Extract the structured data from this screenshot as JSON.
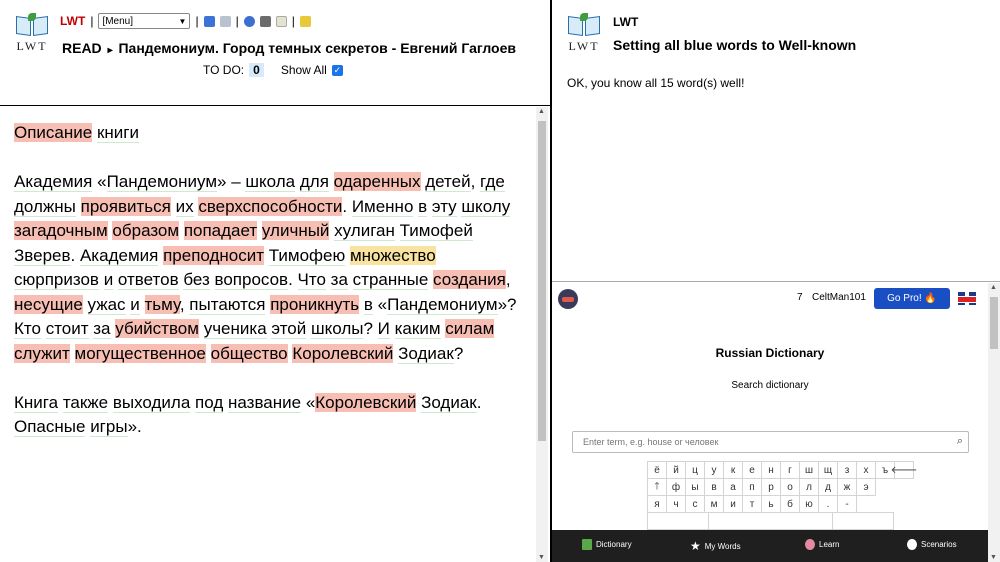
{
  "left": {
    "logo_text": "LWT",
    "toolbar": {
      "lwt": "LWT",
      "sep": "|",
      "menu_value": "[Menu]"
    },
    "title": {
      "mode": "READ",
      "arrow": "▸",
      "text": "Пандемониум. Город темных секретов - Евгений Гаглоев"
    },
    "todo": {
      "label": "TO DO:",
      "count": "0",
      "show_all": "Show All"
    }
  },
  "text": {
    "paragraphs": [
      [
        {
          "t": "Описание",
          "s": "u"
        },
        {
          "t": " "
        },
        {
          "t": "книги",
          "s": "k"
        }
      ],
      [
        {
          "t": "Академия",
          "s": "k"
        },
        {
          "t": " «"
        },
        {
          "t": "Пандемониум",
          "s": "k"
        },
        {
          "t": "» – "
        },
        {
          "t": "школа",
          "s": "k"
        },
        {
          "t": " "
        },
        {
          "t": "для",
          "s": "k"
        },
        {
          "t": " "
        },
        {
          "t": "одаренных",
          "s": "u"
        },
        {
          "t": " "
        },
        {
          "t": "детей",
          "s": "k"
        },
        {
          "t": ", "
        },
        {
          "t": "где",
          "s": "k"
        },
        {
          "t": " "
        },
        {
          "t": "должны",
          "s": "k"
        },
        {
          "t": " "
        },
        {
          "t": "проявиться",
          "s": "u"
        },
        {
          "t": " "
        },
        {
          "t": "их",
          "s": "k"
        },
        {
          "t": " "
        },
        {
          "t": "сверхспособности",
          "s": "u"
        },
        {
          "t": ". "
        },
        {
          "t": "Именно",
          "s": "k"
        },
        {
          "t": " "
        },
        {
          "t": "в",
          "s": "k"
        },
        {
          "t": " "
        },
        {
          "t": "эту",
          "s": "k"
        },
        {
          "t": " "
        },
        {
          "t": "школу",
          "s": "k"
        },
        {
          "t": " "
        },
        {
          "t": "загадочным",
          "s": "u"
        },
        {
          "t": " "
        },
        {
          "t": "образом",
          "s": "u"
        },
        {
          "t": " "
        },
        {
          "t": "попадает",
          "s": "u"
        },
        {
          "t": " "
        },
        {
          "t": "уличный",
          "s": "u"
        },
        {
          "t": " "
        },
        {
          "t": "хулиган",
          "s": "k"
        },
        {
          "t": " "
        },
        {
          "t": "Тимофей",
          "s": "k"
        },
        {
          "t": " "
        },
        {
          "t": "Зверев",
          "s": "k"
        },
        {
          "t": ". "
        },
        {
          "t": "Академия",
          "s": "k"
        },
        {
          "t": " "
        },
        {
          "t": "преподносит",
          "s": "u"
        },
        {
          "t": " "
        },
        {
          "t": "Тимофею",
          "s": "k"
        },
        {
          "t": " "
        },
        {
          "t": "множество",
          "s": "m"
        },
        {
          "t": " "
        },
        {
          "t": "сюрпризов",
          "s": "k"
        },
        {
          "t": " "
        },
        {
          "t": "и",
          "s": "k"
        },
        {
          "t": " "
        },
        {
          "t": "ответов",
          "s": "k"
        },
        {
          "t": " "
        },
        {
          "t": "без",
          "s": "k"
        },
        {
          "t": " "
        },
        {
          "t": "вопросов",
          "s": "k"
        },
        {
          "t": ". "
        },
        {
          "t": "Что",
          "s": "k"
        },
        {
          "t": " "
        },
        {
          "t": "за",
          "s": "k"
        },
        {
          "t": " "
        },
        {
          "t": "странные",
          "s": "k"
        },
        {
          "t": " "
        },
        {
          "t": "создания",
          "s": "u"
        },
        {
          "t": ", "
        },
        {
          "t": "несущие",
          "s": "u"
        },
        {
          "t": " "
        },
        {
          "t": "ужас",
          "s": "k"
        },
        {
          "t": " "
        },
        {
          "t": "и",
          "s": "k"
        },
        {
          "t": " "
        },
        {
          "t": "тьму",
          "s": "u"
        },
        {
          "t": ", "
        },
        {
          "t": "пытаются",
          "s": "k"
        },
        {
          "t": " "
        },
        {
          "t": "проникнуть",
          "s": "u"
        },
        {
          "t": " "
        },
        {
          "t": "в",
          "s": "k"
        },
        {
          "t": " «"
        },
        {
          "t": "Пандемониум",
          "s": "k"
        },
        {
          "t": "»? "
        },
        {
          "t": "Кто",
          "s": "k"
        },
        {
          "t": " "
        },
        {
          "t": "стоит",
          "s": "k"
        },
        {
          "t": " "
        },
        {
          "t": "за",
          "s": "k"
        },
        {
          "t": " "
        },
        {
          "t": "убийством",
          "s": "u"
        },
        {
          "t": " "
        },
        {
          "t": "ученика",
          "s": "k"
        },
        {
          "t": " "
        },
        {
          "t": "этой",
          "s": "k"
        },
        {
          "t": " "
        },
        {
          "t": "школы",
          "s": "k"
        },
        {
          "t": "? "
        },
        {
          "t": "И",
          "s": "k"
        },
        {
          "t": " "
        },
        {
          "t": "каким",
          "s": "k"
        },
        {
          "t": " "
        },
        {
          "t": "силам",
          "s": "u"
        },
        {
          "t": " "
        },
        {
          "t": "служит",
          "s": "u"
        },
        {
          "t": " "
        },
        {
          "t": "могущественное",
          "s": "u"
        },
        {
          "t": " "
        },
        {
          "t": "общество",
          "s": "u"
        },
        {
          "t": " "
        },
        {
          "t": "Королевский",
          "s": "u"
        },
        {
          "t": " "
        },
        {
          "t": "Зодиак",
          "s": "k"
        },
        {
          "t": "?"
        }
      ],
      [
        {
          "t": "Книга",
          "s": "k"
        },
        {
          "t": " "
        },
        {
          "t": "также",
          "s": "k"
        },
        {
          "t": " "
        },
        {
          "t": "выходила",
          "s": "k"
        },
        {
          "t": " "
        },
        {
          "t": "под",
          "s": "k"
        },
        {
          "t": " "
        },
        {
          "t": "название",
          "s": "k"
        },
        {
          "t": " «"
        },
        {
          "t": "Королевский",
          "s": "u"
        },
        {
          "t": " "
        },
        {
          "t": "Зодиак",
          "s": "k"
        },
        {
          "t": ". "
        },
        {
          "t": "Опасные",
          "s": "k"
        },
        {
          "t": " "
        },
        {
          "t": "игры",
          "s": "k"
        },
        {
          "t": "»."
        }
      ]
    ]
  },
  "right_top": {
    "logo_text": "LWT",
    "lwt": "LWT",
    "title": "Setting all blue words to Well-known",
    "message": "OK, you know all 15 word(s) well!"
  },
  "dict": {
    "streak": "7",
    "user": "CeltMan101",
    "gopro": "Go Pro! 🔥",
    "heading": "Russian Dictionary",
    "subheading": "Search dictionary",
    "search_placeholder": "Enter term, e.g. house or человек",
    "keyboard": {
      "row1": [
        "ё",
        "й",
        "ц",
        "у",
        "к",
        "е",
        "н",
        "г",
        "ш",
        "щ",
        "з",
        "х",
        "ъ",
        "🡐"
      ],
      "row2": [
        "🡑",
        "ф",
        "ы",
        "в",
        "а",
        "п",
        "р",
        "о",
        "л",
        "д",
        "ж",
        "э"
      ],
      "row3": [
        "я",
        "ч",
        "с",
        "м",
        "и",
        "т",
        "ь",
        "б",
        "ю",
        ".",
        "-"
      ]
    },
    "nav": {
      "dictionary": "Dictionary",
      "mywords": "My Words",
      "learn": "Learn",
      "scenarios": "Scenarios"
    }
  }
}
